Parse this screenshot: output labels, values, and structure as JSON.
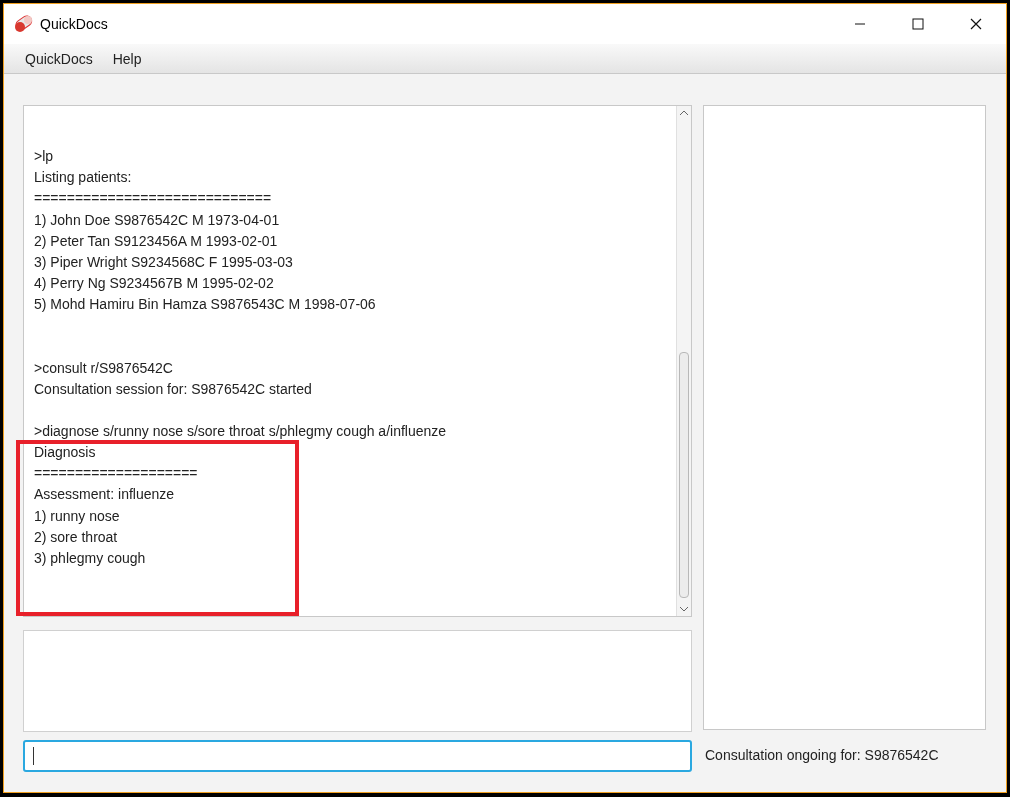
{
  "window": {
    "title": "QuickDocs"
  },
  "menu": [
    "QuickDocs",
    "Help"
  ],
  "output": {
    "blocks": [
      {
        "kind": "listing",
        "lines": [
          ">lp",
          "Listing patients:",
          "=============================",
          "1) John Doe S9876542C M 1973-04-01",
          "2) Peter Tan S9123456A M 1993-02-01",
          "3) Piper Wright S9234568C F 1995-03-03",
          "4) Perry Ng S9234567B M 1995-02-02",
          "5) Mohd Hamiru Bin Hamza S9876543C M 1998-07-06"
        ]
      },
      {
        "kind": "session",
        "lines": [
          ">consult r/S9876542C",
          "Consultation session for: S9876542C started"
        ]
      },
      {
        "kind": "diagnosis",
        "lines": [
          ">diagnose s/runny nose s/sore throat s/phlegmy cough a/influenze",
          "Diagnosis",
          "====================",
          "Assessment: influenze",
          "1) runny nose",
          "2) sore throat",
          "3) phlegmy cough"
        ]
      }
    ]
  },
  "status": "Consultation ongoing for: S9876542C"
}
